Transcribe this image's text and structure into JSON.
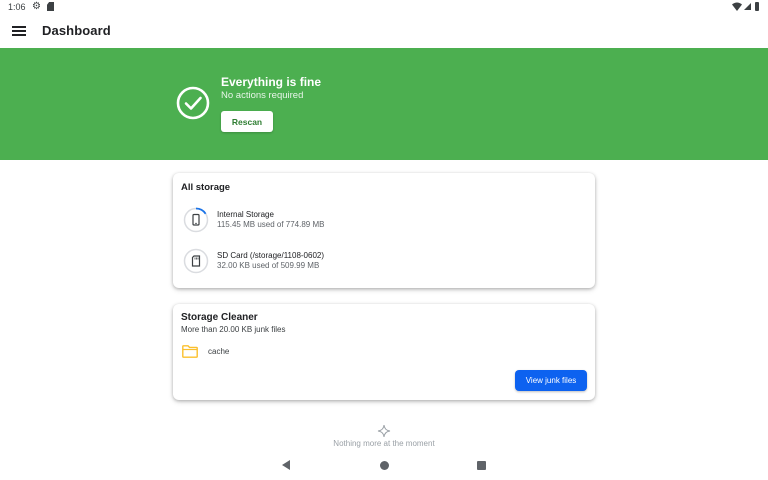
{
  "status_bar": {
    "time": "1:06",
    "icons": [
      "gear-icon",
      "sd-card-icon",
      "wifi-icon",
      "signal-icon",
      "battery-icon"
    ]
  },
  "app_bar": {
    "title": "Dashboard",
    "menu_icon": "menu-icon"
  },
  "hero": {
    "title": "Everything is fine",
    "subtitle": "No actions required",
    "rescan_label": "Rescan",
    "icon": "check-circle-icon",
    "background_color": "#4caf50"
  },
  "all_storage": {
    "title": "All storage",
    "items": [
      {
        "name": "Internal Storage",
        "detail": "115.45 MB used of 774.89 MB",
        "icon": "phone-icon",
        "used_fraction": 0.149
      },
      {
        "name": "SD Card (/storage/1108-0602)",
        "detail": "32.00 KB used of 509.99 MB",
        "icon": "sd-card-icon",
        "used_fraction": 0.0
      }
    ]
  },
  "storage_cleaner": {
    "title": "Storage Cleaner",
    "subtitle": "More than 20.00 KB junk files",
    "folders": [
      {
        "label": "cache",
        "icon": "folder-icon"
      }
    ],
    "view_junk_label": "View junk files",
    "button_color": "#0d62f0"
  },
  "footer": {
    "empty_text": "Nothing more at the moment",
    "icon": "sparkle-icon"
  },
  "nav_bar": {
    "icons": [
      "back-icon",
      "home-icon",
      "recents-icon"
    ]
  }
}
